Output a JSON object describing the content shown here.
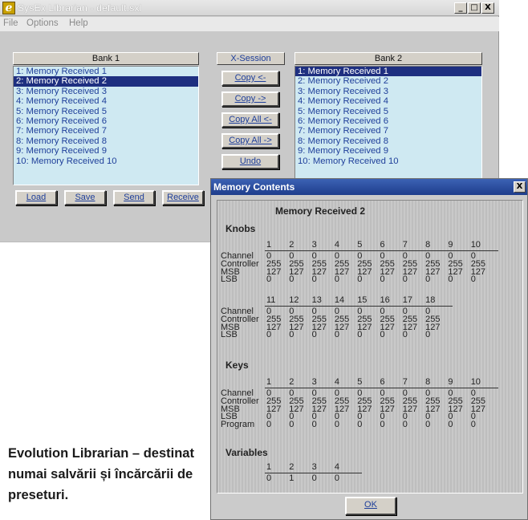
{
  "window": {
    "title": "SysEx Librarian - default.sxl",
    "min_label": "_",
    "max_label": "□",
    "close_label": "X"
  },
  "menu": [
    "File",
    "Options",
    "Help"
  ],
  "bank1": {
    "header": "Bank 1",
    "items": [
      "1: Memory Received 1",
      "2: Memory Received 2",
      "3: Memory Received 3",
      "4: Memory Received 4",
      "5: Memory Received 5",
      "6: Memory Received 6",
      "7: Memory Received 7",
      "8: Memory Received 8",
      "9: Memory Received 9",
      "10: Memory Received 10"
    ],
    "selected_index": 1
  },
  "xsession": {
    "header": "X-Session",
    "buttons": [
      "Copy <-",
      "Copy ->",
      "Copy All <-",
      "Copy All ->",
      "Undo"
    ]
  },
  "bank2": {
    "header": "Bank 2",
    "items": [
      "1: Memory Received 1",
      "2: Memory Received 2",
      "3: Memory Received 3",
      "4: Memory Received 4",
      "5: Memory Received 5",
      "6: Memory Received 6",
      "7: Memory Received 7",
      "8: Memory Received 8",
      "9: Memory Received 9",
      "10: Memory Received 10"
    ],
    "selected_index": 0
  },
  "bottom_buttons": [
    "Load",
    "Save",
    "Send",
    "Receive"
  ],
  "caption": "Evolution Librarian – destinat numai salvării și încărcării de preseturi.",
  "dialog": {
    "title": "Memory Contents",
    "close_label": "X",
    "memory_name": "Memory Received 2",
    "ok_label": "OK",
    "sections": [
      {
        "name": "Knobs",
        "groups": [
          {
            "cols": [
              "1",
              "2",
              "3",
              "4",
              "5",
              "6",
              "7",
              "8",
              "9",
              "10"
            ],
            "rows": [
              {
                "label": "Channel",
                "values": [
                  "0",
                  "0",
                  "0",
                  "0",
                  "0",
                  "0",
                  "0",
                  "0",
                  "0",
                  "0"
                ]
              },
              {
                "label": "Controller",
                "values": [
                  "255",
                  "255",
                  "255",
                  "255",
                  "255",
                  "255",
                  "255",
                  "255",
                  "255",
                  "255"
                ]
              },
              {
                "label": "MSB",
                "values": [
                  "127",
                  "127",
                  "127",
                  "127",
                  "127",
                  "127",
                  "127",
                  "127",
                  "127",
                  "127"
                ]
              },
              {
                "label": "LSB",
                "values": [
                  "0",
                  "0",
                  "0",
                  "0",
                  "0",
                  "0",
                  "0",
                  "0",
                  "0",
                  "0"
                ]
              }
            ]
          },
          {
            "cols": [
              "11",
              "12",
              "13",
              "14",
              "15",
              "16",
              "17",
              "18"
            ],
            "rows": [
              {
                "label": "Channel",
                "values": [
                  "0",
                  "0",
                  "0",
                  "0",
                  "0",
                  "0",
                  "0",
                  "0"
                ]
              },
              {
                "label": "Controller",
                "values": [
                  "255",
                  "255",
                  "255",
                  "255",
                  "255",
                  "255",
                  "255",
                  "255"
                ]
              },
              {
                "label": "MSB",
                "values": [
                  "127",
                  "127",
                  "127",
                  "127",
                  "127",
                  "127",
                  "127",
                  "127"
                ]
              },
              {
                "label": "LSB",
                "values": [
                  "0",
                  "0",
                  "0",
                  "0",
                  "0",
                  "0",
                  "0",
                  "0"
                ]
              }
            ]
          }
        ]
      },
      {
        "name": "Keys",
        "groups": [
          {
            "cols": [
              "1",
              "2",
              "3",
              "4",
              "5",
              "6",
              "7",
              "8",
              "9",
              "10"
            ],
            "rows": [
              {
                "label": "Channel",
                "values": [
                  "0",
                  "0",
                  "0",
                  "0",
                  "0",
                  "0",
                  "0",
                  "0",
                  "0",
                  "0"
                ]
              },
              {
                "label": "Controller",
                "values": [
                  "255",
                  "255",
                  "255",
                  "255",
                  "255",
                  "255",
                  "255",
                  "255",
                  "255",
                  "255"
                ]
              },
              {
                "label": "MSB",
                "values": [
                  "127",
                  "127",
                  "127",
                  "127",
                  "127",
                  "127",
                  "127",
                  "127",
                  "127",
                  "127"
                ]
              },
              {
                "label": "LSB",
                "values": [
                  "0",
                  "0",
                  "0",
                  "0",
                  "0",
                  "0",
                  "0",
                  "0",
                  "0",
                  "0"
                ]
              },
              {
                "label": "Program",
                "values": [
                  "0",
                  "0",
                  "0",
                  "0",
                  "0",
                  "0",
                  "0",
                  "0",
                  "0",
                  "0"
                ]
              }
            ]
          }
        ]
      },
      {
        "name": "Variables",
        "groups": [
          {
            "cols": [
              "1",
              "2",
              "3",
              "4"
            ],
            "rows": [
              {
                "label": "",
                "values": [
                  "0",
                  "1",
                  "0",
                  "0"
                ]
              }
            ]
          }
        ]
      }
    ]
  }
}
